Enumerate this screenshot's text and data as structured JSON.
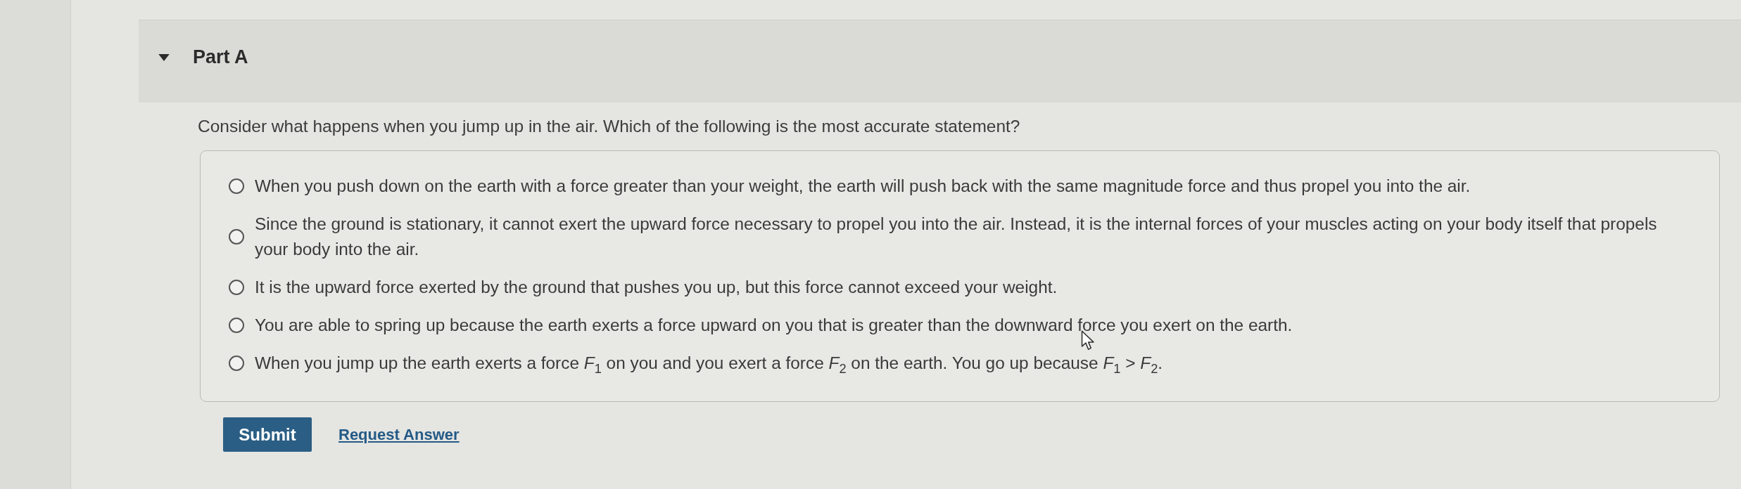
{
  "section": {
    "title": "Part A",
    "expanded": true
  },
  "question": "Consider what happens when you jump up in the air. Which of the following is the most accurate statement?",
  "options": [
    {
      "text": "When you push down on the earth with a force greater than your weight, the earth will push back with the same magnitude force and thus propel you into the air.",
      "selected": false
    },
    {
      "text": "Since the ground is stationary, it cannot exert the upward force necessary to propel you into the air. Instead, it is the internal forces of your muscles acting on your body itself that propels your body into the air.",
      "selected": false
    },
    {
      "text": "It is the upward force exerted by the ground that pushes you up, but this force cannot exceed your weight.",
      "selected": false
    },
    {
      "text": "You are able to spring up because the earth exerts a force upward on you that is greater than the downward force you exert on the earth.",
      "selected": false
    },
    {
      "text": "When you jump up the earth exerts a force *F*$_{1}$ on you and you exert a force *F*$_{2}$ on the earth. You go up because *F*$_{1}$ > *F*$_{2}$.",
      "selected": false
    }
  ],
  "actions": {
    "submit": "Submit",
    "request_answer": "Request Answer"
  }
}
